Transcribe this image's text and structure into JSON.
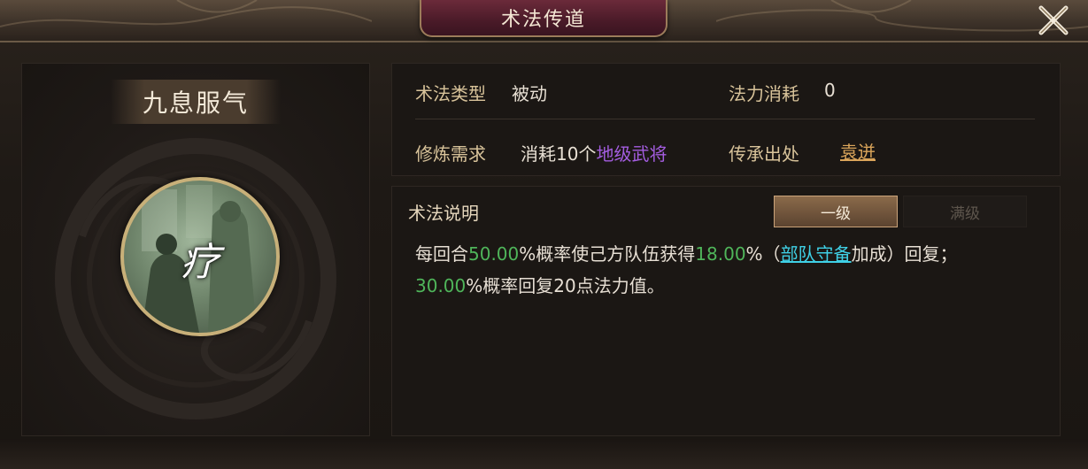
{
  "window": {
    "title": "术法传道",
    "close_icon": "close-x-icon"
  },
  "skill": {
    "name": "九息服气",
    "portrait_glyph": "疗"
  },
  "info": {
    "type_label": "术法类型",
    "type_value": "被动",
    "cost_label": "法力消耗",
    "cost_value": "0",
    "req_label": "修炼需求",
    "req_prefix": "消耗10个",
    "req_highlight": "地级武将",
    "origin_label": "传承出处",
    "origin_value": "袁迸"
  },
  "description": {
    "title": "术法说明",
    "tabs": [
      {
        "label": "一级",
        "active": true
      },
      {
        "label": "满级",
        "active": false
      }
    ],
    "line1": {
      "t1": "每回合",
      "v1": "50.00",
      "t2": "%概率使己方队伍获得",
      "v2": "18.00",
      "t3": "%（",
      "link": "部队守备",
      "t4": "加成）回复；"
    },
    "line2": {
      "v1": "30.00",
      "t1": "%概率回复20点法力值。"
    }
  },
  "colors": {
    "value_green": "#4fb55a",
    "link_cyan": "#3fd0e6",
    "highlight_purple": "#a45de0",
    "origin_link": "#d9a45a",
    "title_plate": "#4a1a28"
  }
}
